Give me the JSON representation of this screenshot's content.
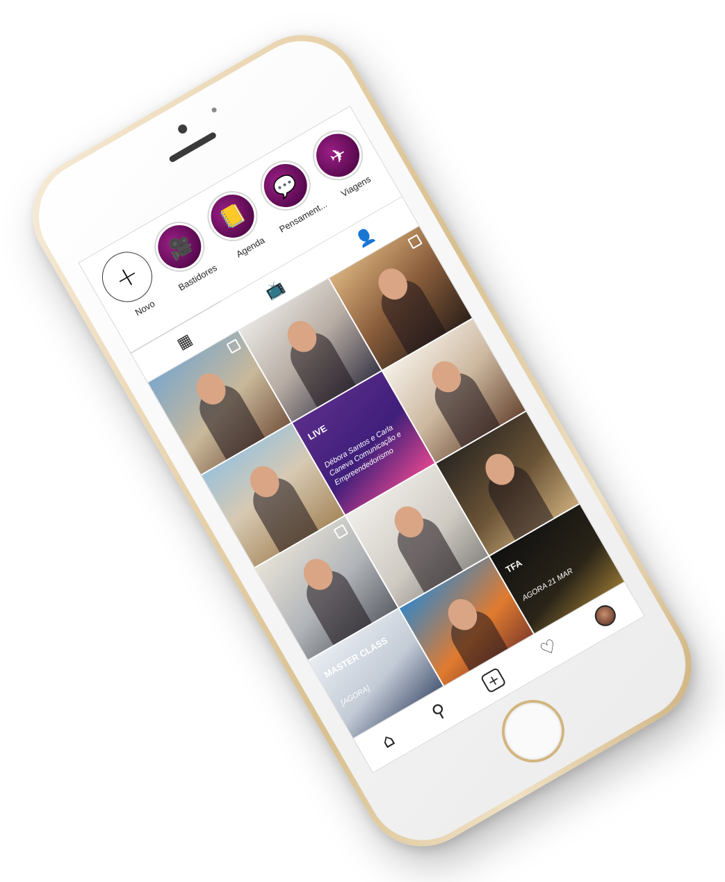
{
  "highlights": [
    {
      "label": "Novo",
      "icon": "plus-icon",
      "is_new": true,
      "glyph": "+"
    },
    {
      "label": "Bastidores",
      "icon": "movie-camera-icon",
      "glyph": "🎥"
    },
    {
      "label": "Agenda",
      "icon": "agenda-book-icon",
      "glyph": "📒"
    },
    {
      "label": "Pensament...",
      "icon": "speech-bubble-icon",
      "glyph": "💬"
    },
    {
      "label": "Viagens",
      "icon": "airplane-icon",
      "glyph": "✈"
    }
  ],
  "tabs": [
    {
      "name": "grid",
      "icon": "grid-icon",
      "glyph": "▦",
      "active": true
    },
    {
      "name": "igtv",
      "icon": "igtv-icon",
      "glyph": "📺",
      "active": false
    },
    {
      "name": "tagged",
      "icon": "tagged-person-icon",
      "glyph": "👤",
      "active": false
    }
  ],
  "posts": [
    {
      "bg": "linear-gradient(160deg,#7fa8c9 0%,#c9b89a 55%,#7a5a44 100%)",
      "multi": true,
      "kind": "photo"
    },
    {
      "bg": "linear-gradient(160deg,#e8e6e2 0%,#b7aca3 50%,#3d3a4a 100%)",
      "multi": false,
      "kind": "photo"
    },
    {
      "bg": "linear-gradient(160deg,#d8b07c 0%,#8a5d3b 50%,#2e221a 100%)",
      "multi": true,
      "kind": "photo"
    },
    {
      "bg": "linear-gradient(170deg,#9dc2d8 0%,#d7c9b3 45%,#a7895e 100%)",
      "multi": false,
      "kind": "photo"
    },
    {
      "bg": "linear-gradient(160deg,#5a2d8a 0%,#3f1f7a 55%,#e0468f 100%)",
      "multi": false,
      "kind": "poster",
      "title": "LIVE",
      "subtitle": "Débora Santos e Carla Caneva",
      "caption": "Comunicação e Empreendedorismo"
    },
    {
      "bg": "linear-gradient(160deg,#f4efe6 0%,#cdb8a0 50%,#6b4a36 100%)",
      "multi": false,
      "kind": "photo"
    },
    {
      "bg": "linear-gradient(160deg,#e6e2d7 0%,#b1b4b8 55%,#5f636a 100%)",
      "multi": true,
      "kind": "photo"
    },
    {
      "bg": "linear-gradient(160deg,#f0eeea 0%,#cfcac2 60%,#8c8a86 100%)",
      "multi": false,
      "kind": "photo"
    },
    {
      "bg": "linear-gradient(160deg,#2b2622 0%,#6b5436 55%,#c7a978 100%)",
      "multi": false,
      "kind": "photo"
    },
    {
      "bg": "linear-gradient(160deg,#e9edf2 0%,#c3cbd6 50%,#2b3a5c 100%)",
      "multi": false,
      "kind": "poster",
      "title": "MASTER CLASS",
      "subtitle": "[AGORA]",
      "caption": ""
    },
    {
      "bg": "linear-gradient(160deg,#3a86c2 0%,#e07b2f 55%,#6a2d2a 100%)",
      "multi": false,
      "kind": "photo"
    },
    {
      "bg": "linear-gradient(160deg,#111 0%,#2a2418 55%,#b08a3a 100%)",
      "multi": false,
      "kind": "poster",
      "title": "TFA",
      "subtitle": "AGORA",
      "caption": "21 MAR"
    }
  ],
  "bottom_nav": [
    {
      "name": "home",
      "icon": "home-icon",
      "glyph": "⌂"
    },
    {
      "name": "search",
      "icon": "search-icon",
      "glyph": "⚲"
    },
    {
      "name": "new-post",
      "icon": "plus-square-icon",
      "glyph": "+"
    },
    {
      "name": "activity",
      "icon": "heart-icon",
      "glyph": "♡"
    },
    {
      "name": "profile",
      "icon": "avatar-icon",
      "glyph": ""
    }
  ]
}
